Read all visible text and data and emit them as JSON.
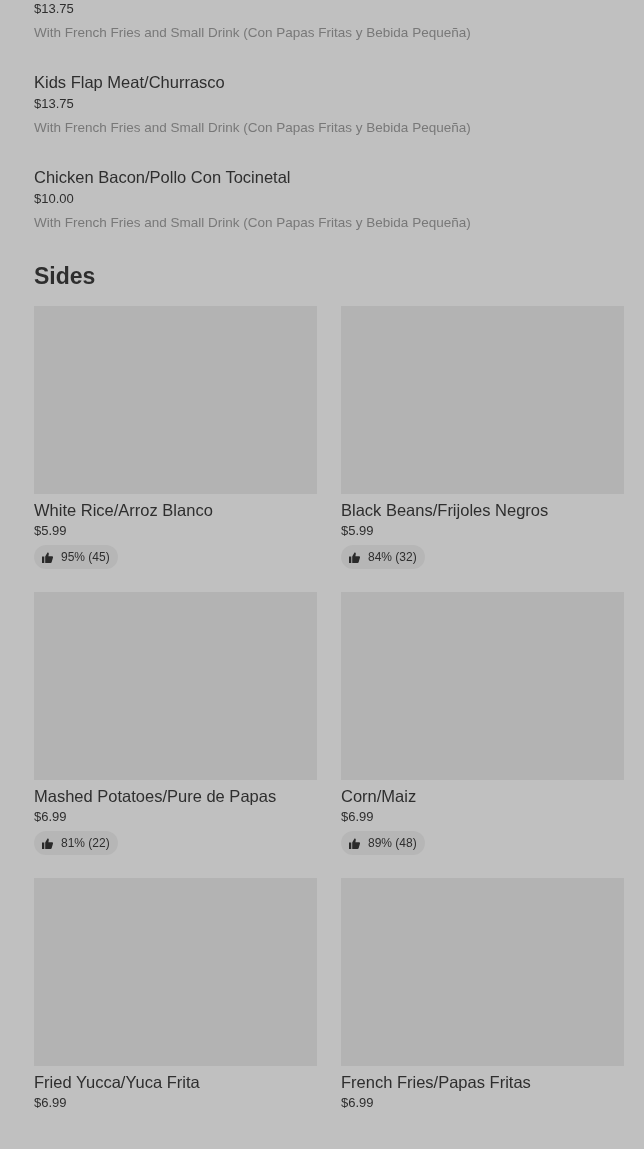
{
  "items": [
    {
      "price": "$13.75",
      "description": "With French Fries and Small Drink (Con Papas Fritas y Bebida Pequeña)"
    },
    {
      "name": "Kids Flap Meat/Churrasco",
      "price": "$13.75",
      "description": "With French Fries and Small Drink (Con Papas Fritas y Bebida Pequeña)"
    },
    {
      "name": "Chicken Bacon/Pollo Con Tocinetal",
      "price": "$10.00",
      "description": "With French Fries and Small Drink (Con Papas Fritas y Bebida Pequeña)"
    }
  ],
  "section": {
    "title": "Sides",
    "cards": [
      {
        "name": "White Rice/Arroz Blanco",
        "price": "$5.99",
        "rating": "95% (45)"
      },
      {
        "name": "Black Beans/Frijoles Negros",
        "price": "$5.99",
        "rating": "84% (32)"
      },
      {
        "name": "Mashed Potatoes/Pure de Papas",
        "price": "$6.99",
        "rating": "81% (22)"
      },
      {
        "name": "Corn/Maiz",
        "price": "$6.99",
        "rating": "89% (48)"
      },
      {
        "name": " Fried Yucca/Yuca Frita",
        "price": "$6.99"
      },
      {
        "name": "French Fries/Papas Fritas",
        "price": "$6.99"
      }
    ]
  }
}
